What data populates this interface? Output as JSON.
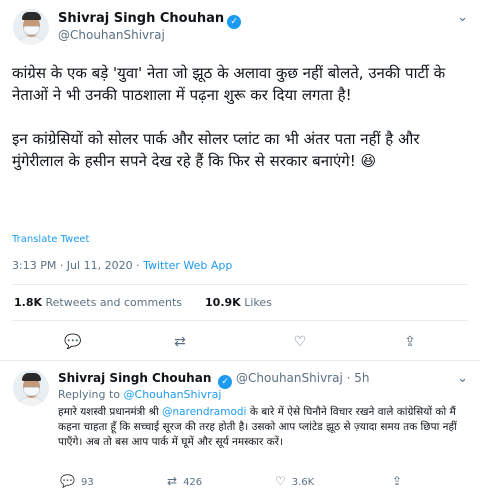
{
  "tweet": {
    "author_name": "Shivraj Singh Chouhan",
    "handle": "@ChouhanShivraj",
    "verified_mark": "✓",
    "paragraph_1": "कांग्रेस के एक बड़े 'युवा' नेता जो झूठ के अलावा कुछ नहीं बोलते, उनकी पार्टी के नेताओं ने भी उनकी पाठशाला में पढ़ना शुरू कर दिया लगता है!",
    "paragraph_2": "इन कांग्रेसियों को सोलर पार्क और सोलर प्लांट का भी अंतर पता नहीं है और मुंगेरीलाल के हसीन सपने देख रहे हैं कि फिर से सरकार बनाएंगे!",
    "emoji": "😆",
    "translate_label": "Translate Tweet",
    "time": "3:13 PM · Jul 11, 2020 · ",
    "source_app": "Twitter Web App",
    "retweets_count": "1.8K",
    "retweets_label": "Retweets and comments",
    "likes_count": "10.9K",
    "likes_label": "Likes"
  },
  "icons": {
    "chevron": "⌄",
    "reply": "💬",
    "retweet": "⇄",
    "like": "♡",
    "share": "⇪"
  },
  "reply": {
    "author_name": "Shivraj Singh Chouhan",
    "handle_time": "@ChouhanShivraj · 5h",
    "replying_prefix": "Replying to ",
    "replying_to": "@ChouhanShivraj",
    "text_before": "हमारे यशस्वी प्रधानमंत्री श्री ",
    "mention": "@narendramodi",
    "text_after": " के बारे में ऐसे घिनौने विचार रखने वाले कांग्रेसियों को मैं कहना चाहता हूँ कि सच्चाई सूरज की तरह होती है। उसको आप प्लांटेड झूठ से ज़्यादा समय तक छिपा नहीं पाएँगे। अब तो बस आप पार्क में घूमें और सूर्य नमस्कार करें।",
    "reply_count": "93",
    "retweet_count": "426",
    "like_count": "3.6K"
  },
  "colors": {
    "accent": "#1d9bf0",
    "muted": "#5b7083",
    "divider": "#e6ecf0"
  }
}
